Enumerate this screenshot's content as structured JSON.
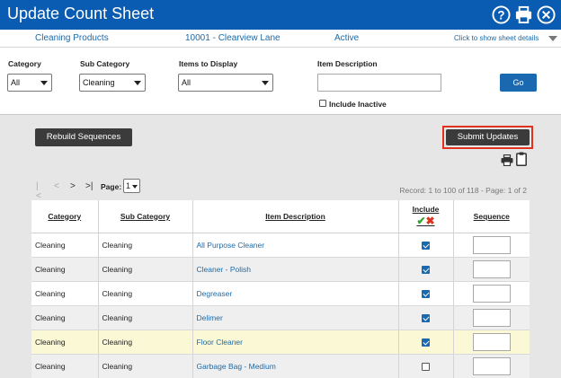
{
  "window": {
    "title": "Update Count Sheet",
    "icons": [
      "help-icon",
      "print-icon",
      "close-icon"
    ]
  },
  "info": {
    "category": "Cleaning Products",
    "location": "10001 - Clearview Lane",
    "status": "Active",
    "details_link": "Click to show sheet details"
  },
  "filters": {
    "category_label": "Category",
    "category_value": "All",
    "subcategory_label": "Sub Category",
    "subcategory_value": "Cleaning",
    "items_label": "Items to Display",
    "items_value": "All",
    "description_label": "Item Description",
    "description_value": "",
    "include_inactive_label": "Include Inactive",
    "include_inactive_checked": false,
    "go_label": "Go"
  },
  "actions": {
    "rebuild_label": "Rebuild Sequences",
    "submit_label": "Submit Updates",
    "highlight_color": "#e0321c"
  },
  "pager": {
    "first": "|<",
    "prev": "<",
    "next": ">",
    "last": ">|",
    "page_label": "Page:",
    "page_value": "1",
    "record_text": "Record: 1 to 100 of 118 - Page: 1 of 2"
  },
  "table": {
    "headers": {
      "category": "Category",
      "subcategory": "Sub Category",
      "description": "Item Description",
      "include": "Include",
      "sequence": "Sequence"
    },
    "rows": [
      {
        "category": "Cleaning",
        "subcategory": "Cleaning",
        "description": "All Purpose Cleaner",
        "include": true,
        "sequence": ""
      },
      {
        "category": "Cleaning",
        "subcategory": "Cleaning",
        "description": "Cleaner - Polish",
        "include": true,
        "sequence": ""
      },
      {
        "category": "Cleaning",
        "subcategory": "Cleaning",
        "description": "Degreaser",
        "include": true,
        "sequence": ""
      },
      {
        "category": "Cleaning",
        "subcategory": "Cleaning",
        "description": "Delimer",
        "include": true,
        "sequence": ""
      },
      {
        "category": "Cleaning",
        "subcategory": "Cleaning",
        "description": "Floor Cleaner",
        "include": true,
        "sequence": ""
      },
      {
        "category": "Cleaning",
        "subcategory": "Cleaning",
        "description": "Garbage Bag - Medium",
        "include": false,
        "sequence": ""
      }
    ]
  },
  "colors": {
    "header_blue": "#0a5cb2",
    "link_blue": "#1d6aa8",
    "dark_button": "#3b3b3b",
    "row_highlight": "#fbf8d6"
  }
}
